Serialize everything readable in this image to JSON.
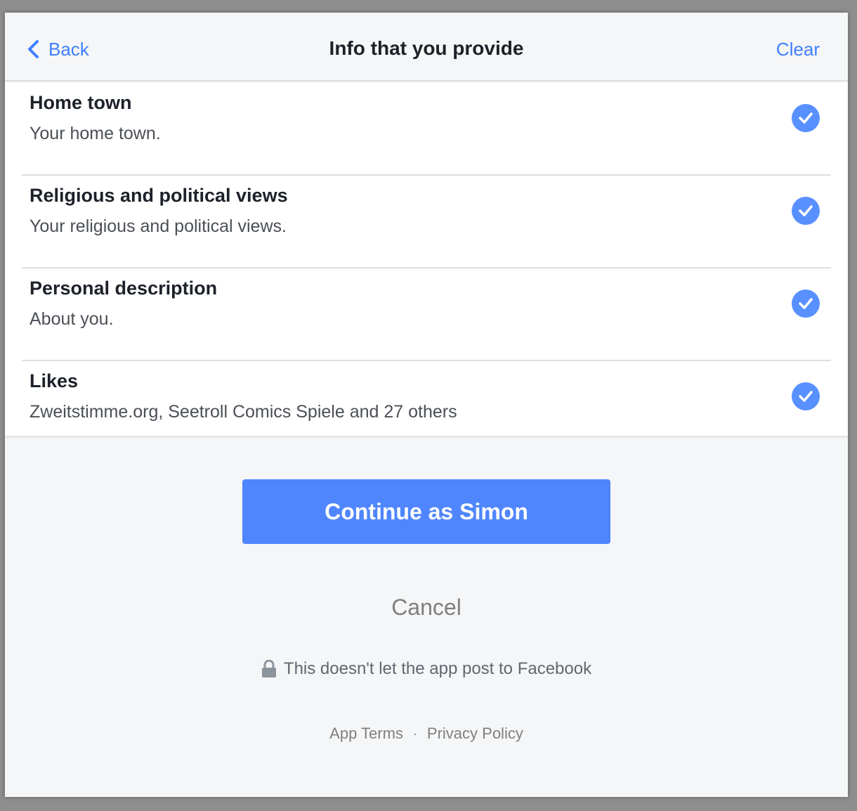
{
  "header": {
    "back_label": "Back",
    "title": "Info that you provide",
    "clear_label": "Clear"
  },
  "permissions": [
    {
      "title": "Home town",
      "description": "Your home town.",
      "checked": true
    },
    {
      "title": "Religious and political views",
      "description": "Your religious and political views.",
      "checked": true
    },
    {
      "title": "Personal description",
      "description": "About you.",
      "checked": true
    },
    {
      "title": "Likes",
      "description": "Zweitstimme.org, Seetroll Comics Spiele and 27 others",
      "checked": true
    }
  ],
  "actions": {
    "continue_label": "Continue as Simon",
    "cancel_label": "Cancel"
  },
  "notice": {
    "icon": "lock-icon",
    "text": "This doesn't let the app post to Facebook"
  },
  "footer": {
    "app_terms": "App Terms",
    "separator": "·",
    "privacy_policy": "Privacy Policy"
  },
  "colors": {
    "accent": "#4080ff",
    "button": "#4f86fe",
    "check": "#5890ff",
    "background": "#f5f6f7"
  }
}
